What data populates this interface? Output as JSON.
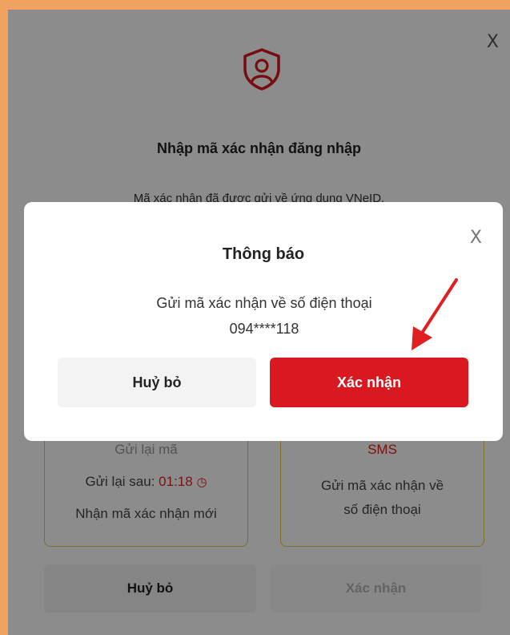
{
  "outer_dialog": {
    "title": "Nhập mã xác nhận đăng nhập",
    "subtitle": "Mã xác nhận đã được gửi về ứng dụng VNeID.",
    "close_label": "X",
    "resend_card": {
      "header": "Gửi lại mã",
      "countdown_label": "Gửi lại sau:",
      "countdown_value": "01:18",
      "description": "Nhận mã xác nhận mới"
    },
    "sms_card": {
      "header": "SMS",
      "description_line1": "Gửi mã xác nhận về",
      "description_line2": "số điện thoại"
    },
    "cancel_label": "Huỷ bỏ",
    "confirm_label": "Xác nhận"
  },
  "modal": {
    "title": "Thông báo",
    "message_line1": "Gửi mã xác nhận về số điện thoại",
    "message_line2": "094****118",
    "close_label": "X",
    "cancel_label": "Huỷ bỏ",
    "confirm_label": "Xác nhận"
  },
  "colors": {
    "accent_red": "#d9181f",
    "card_border": "#e5c74a",
    "frame_orange": "#f0a35e"
  }
}
